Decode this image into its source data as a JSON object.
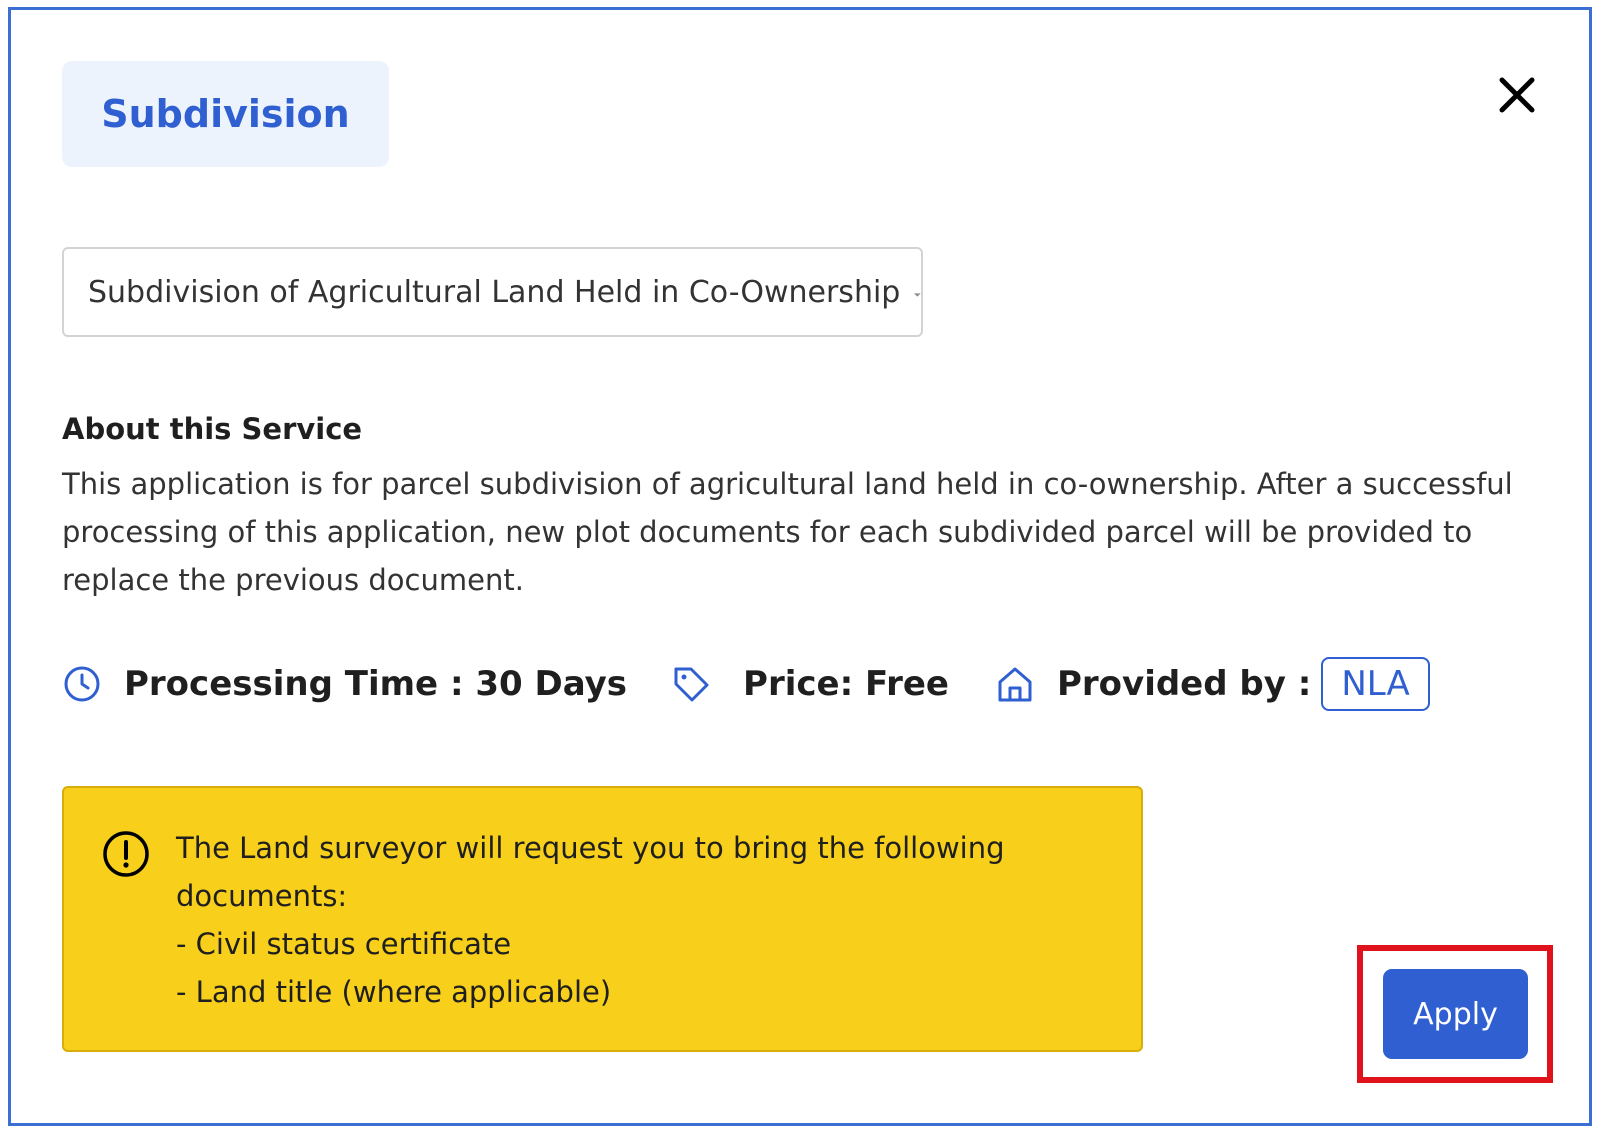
{
  "header": {
    "category_label": "Subdivision",
    "close_label": "close"
  },
  "service_select": {
    "selected_value": "Subdivision of Agricultural Land Held in Co-Ownership"
  },
  "about": {
    "heading": "About this Service",
    "body": "This application is for parcel subdivision of agricultural land held in co-ownership. After a successful processing of this application, new plot documents for each subdivided parcel will be provided to replace the previous document."
  },
  "meta": {
    "processing_time": "Processing Time : 30 Days",
    "price": "Price: Free",
    "provided_by_label": "Provided by :",
    "provider": "NLA"
  },
  "notice": {
    "lines": [
      "The Land surveyor will request you to bring the following",
      "documents:",
      "- Civil status certificate",
      "- Land title (where applicable)"
    ]
  },
  "actions": {
    "apply_label": "Apply"
  },
  "colors": {
    "accent": "#2f5fd0",
    "pill_bg": "#edf3fd",
    "notice_bg": "#f8cf1b",
    "highlight": "#e0121b"
  },
  "icons": {
    "close": "close-icon",
    "caret": "caret-down-icon",
    "clock": "clock-icon",
    "price": "tag-icon",
    "provider": "home-icon",
    "notice": "alert-circle-icon"
  }
}
